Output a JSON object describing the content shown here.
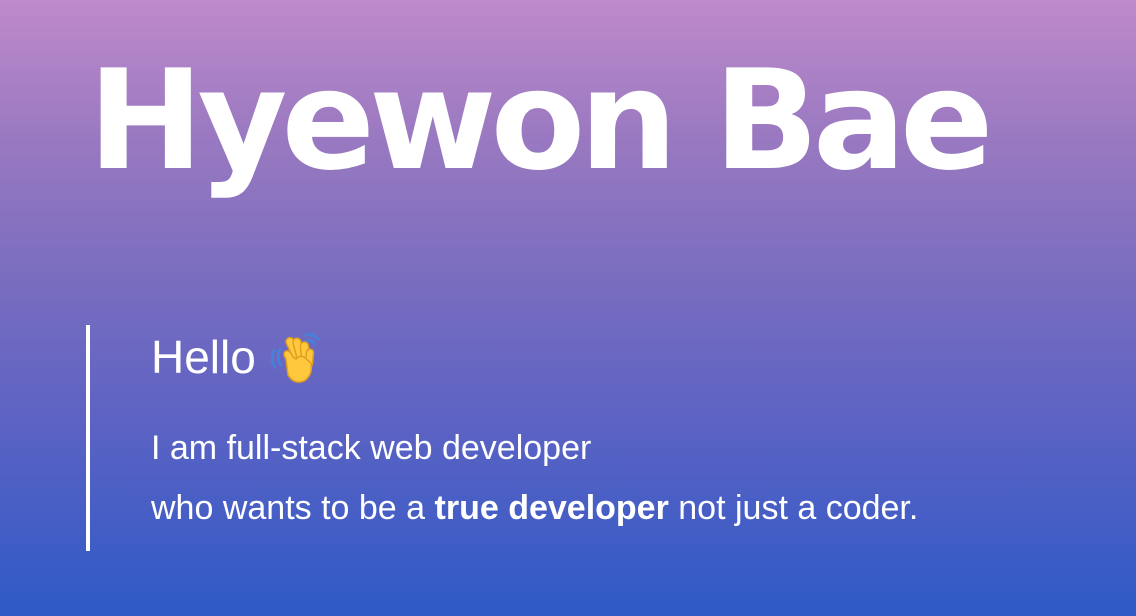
{
  "hero": {
    "name": "Hyewon Bae"
  },
  "intro": {
    "greeting": "Hello",
    "greeting_icon": "waving-hand-icon",
    "line1": "I am full-stack web developer",
    "line2_prefix": "who wants to be a ",
    "line2_emphasis": "true developer",
    "line2_suffix": " not just a coder."
  },
  "colors": {
    "gradient_top": "#bf8acb",
    "gradient_bottom": "#2e5ac6",
    "text": "#ffffff",
    "wave_yellow": "#ffc83d",
    "wave_blue": "#4a7fd6"
  }
}
